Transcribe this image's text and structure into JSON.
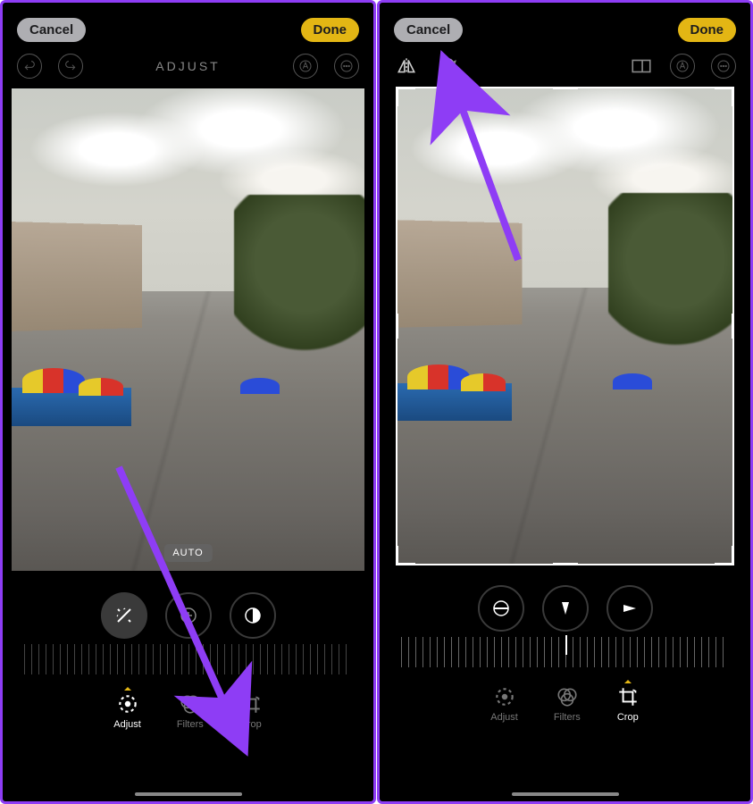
{
  "left": {
    "topbar": {
      "cancel": "Cancel",
      "done": "Done"
    },
    "title": "ADJUST",
    "auto_badge": "AUTO",
    "tabs": {
      "adjust": "Adjust",
      "filters": "Filters",
      "crop": "Crop",
      "active": "adjust"
    }
  },
  "right": {
    "topbar": {
      "cancel": "Cancel",
      "done": "Done"
    },
    "tabs": {
      "adjust": "Adjust",
      "filters": "Filters",
      "crop": "Crop",
      "active": "crop"
    }
  },
  "colors": {
    "accent": "#e3b614",
    "annotation": "#8e3df5"
  }
}
